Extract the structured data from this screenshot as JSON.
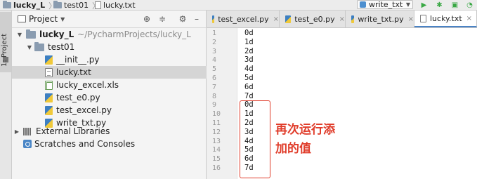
{
  "breadcrumb": {
    "project": "lucky_L",
    "folder": "test01",
    "file": "lucky.txt"
  },
  "run_config": {
    "name": "write_txt"
  },
  "panel": {
    "title": "Project",
    "side_tab_label": "1: Project",
    "tree": {
      "root": {
        "name": "lucky_L",
        "path": "~/PycharmProjects/lucky_L"
      },
      "folder": "test01",
      "files": [
        "__init__.py",
        "lucky.txt",
        "lucky_excel.xls",
        "test_e0.py",
        "test_excel.py",
        "write_txt.py"
      ],
      "external_libraries": "External Libraries",
      "scratches": "Scratches and Consoles"
    }
  },
  "tabs": [
    {
      "label": "test_excel.py"
    },
    {
      "label": "test_e0.py"
    },
    {
      "label": "write_txt.py"
    },
    {
      "label": "lucky.txt"
    }
  ],
  "editor": {
    "line_numbers": [
      "1",
      "2",
      "3",
      "4",
      "5",
      "6",
      "7",
      "8",
      "9",
      "10",
      "11",
      "12",
      "13",
      "14",
      "15",
      "16"
    ],
    "lines": [
      "0d",
      "1d",
      "2d",
      "3d",
      "4d",
      "5d",
      "6d",
      "7d",
      "0d",
      "1d",
      "2d",
      "3d",
      "4d",
      "5d",
      "6d",
      "7d"
    ]
  },
  "annotation": {
    "line1": "再次运行添",
    "line2": "加的值",
    "color": "#e03c2a"
  }
}
